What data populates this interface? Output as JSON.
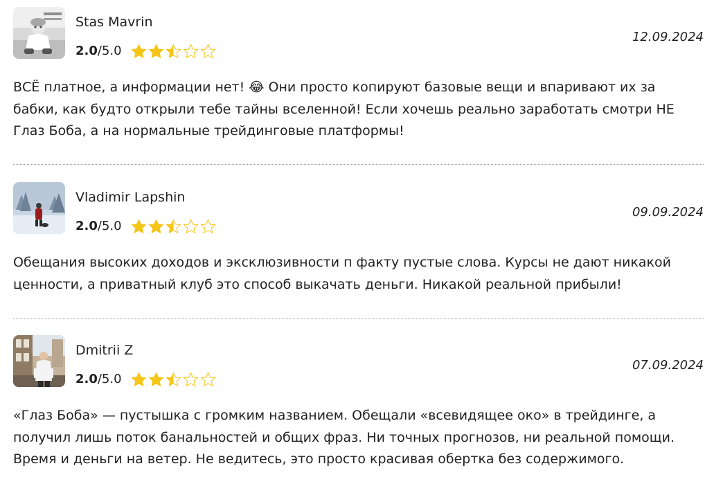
{
  "colors": {
    "star_fill": "#f5c518",
    "star_outline": "#f5c518",
    "divider": "#9a9a9a",
    "text": "#222222"
  },
  "reviews": [
    {
      "author": "Stas Mavrin",
      "avatar_icon": "avatar-photo-child",
      "score": "2.0",
      "out_of": "/5.0",
      "rating": 2.5,
      "date": "12.09.2024",
      "text": "ВСЁ платное, а информации нет! 😂 Они просто копируют базовые вещи и впаривают их за бабки, как будто открыли тебе тайны вселенной! Если хочешь реально заработать смотри НЕ Глаз Боба, а на нормальные трейдинговые платформы!"
    },
    {
      "author": "Vladimir Lapshin",
      "avatar_icon": "avatar-photo-winter",
      "score": "2.0",
      "out_of": "/5.0",
      "rating": 2.5,
      "date": "09.09.2024",
      "text": "Обещания высоких доходов и эксклюзивности п факту пустые слова. Курсы не дают никакой ценности, а приватный клуб это способ выкачать деньги. Никакой реальной прибыли!"
    },
    {
      "author": "Dmitrii Z",
      "avatar_icon": "avatar-photo-street",
      "score": "2.0",
      "out_of": "/5.0",
      "rating": 2.5,
      "date": "07.09.2024",
      "text": "«Глаз Боба» — пустышка с громким названием. Обещали «всевидящее око» в трейдинге, а получил лишь поток банальностей и общих фраз. Ни точных прогнозов, ни реальной помощи. Время и деньги на ветер. Не ведитесь, это просто красивая обертка без содержимого."
    }
  ]
}
